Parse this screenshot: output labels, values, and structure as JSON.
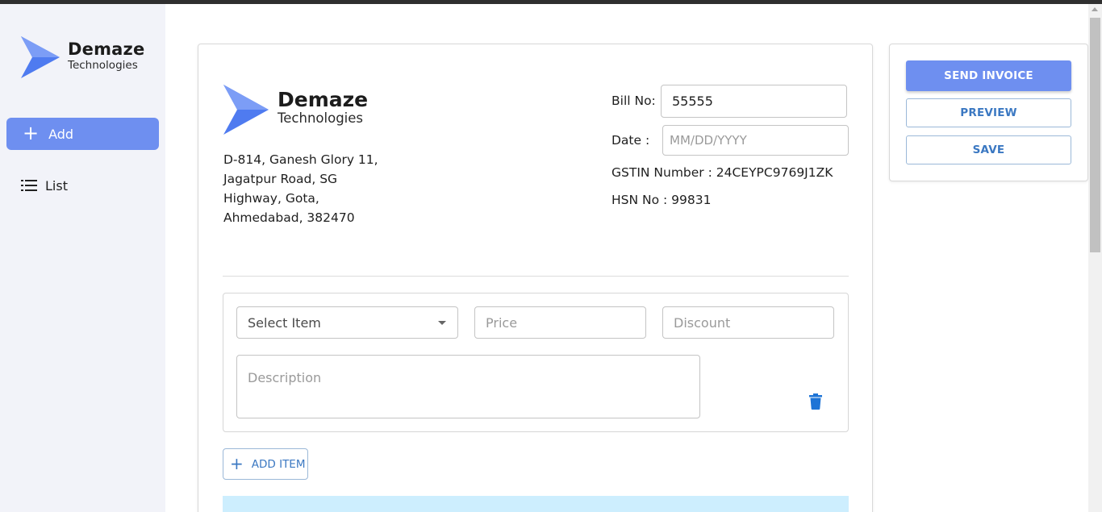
{
  "sidebar": {
    "logo": {
      "brand": "Demaze",
      "subtitle": "Technologies",
      "icon": "arrow-chevron-logo"
    },
    "nav": [
      {
        "label": "Add",
        "icon": "plus-icon",
        "active": true
      },
      {
        "label": "List",
        "icon": "list-icon",
        "active": false
      }
    ]
  },
  "invoice": {
    "logo": {
      "brand": "Demaze",
      "subtitle": "Technologies"
    },
    "address": [
      "D-814, Ganesh Glory 11,",
      "Jagatpur Road, SG",
      "Highway, Gota,",
      "Ahmedabad, 382470"
    ],
    "bill_label": "Bill No:",
    "bill_value": "55555",
    "date_label": "Date :",
    "date_placeholder": "MM/DD/YYYY",
    "gstin": "GSTIN Number : 24CEYPC9769J1ZK",
    "hsn": "HSN No : 99831"
  },
  "item": {
    "select_placeholder": "Select Item",
    "price_placeholder": "Price",
    "discount_placeholder": "Discount",
    "description_placeholder": "Description",
    "delete_icon": "trash-icon"
  },
  "add_item_label": "ADD ITEM",
  "actions": {
    "send": "SEND INVOICE",
    "preview": "PREVIEW",
    "save": "SAVE"
  },
  "colors": {
    "accent": "#6e8ff0",
    "link": "#3b78c2",
    "logo": "#4f7bf0",
    "band": "#cdeefe"
  }
}
